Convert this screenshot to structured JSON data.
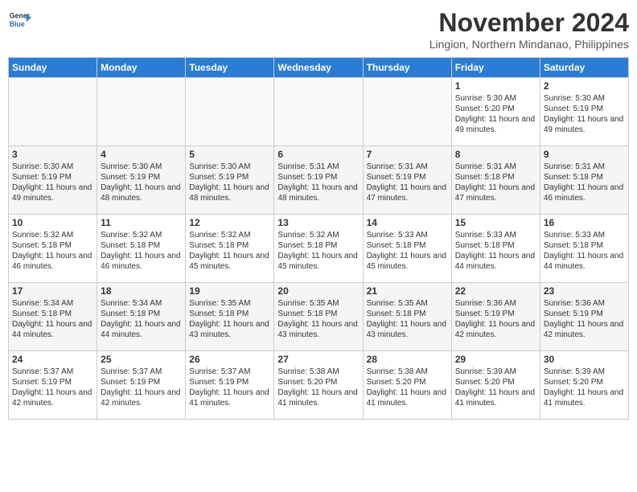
{
  "header": {
    "logo_line1": "General",
    "logo_line2": "Blue",
    "month": "November 2024",
    "location": "Lingion, Northern Mindanao, Philippines"
  },
  "days_of_week": [
    "Sunday",
    "Monday",
    "Tuesday",
    "Wednesday",
    "Thursday",
    "Friday",
    "Saturday"
  ],
  "weeks": [
    [
      {
        "day": "",
        "info": ""
      },
      {
        "day": "",
        "info": ""
      },
      {
        "day": "",
        "info": ""
      },
      {
        "day": "",
        "info": ""
      },
      {
        "day": "",
        "info": ""
      },
      {
        "day": "1",
        "info": "Sunrise: 5:30 AM\nSunset: 5:20 PM\nDaylight: 11 hours and 49 minutes."
      },
      {
        "day": "2",
        "info": "Sunrise: 5:30 AM\nSunset: 5:19 PM\nDaylight: 11 hours and 49 minutes."
      }
    ],
    [
      {
        "day": "3",
        "info": "Sunrise: 5:30 AM\nSunset: 5:19 PM\nDaylight: 11 hours and 49 minutes."
      },
      {
        "day": "4",
        "info": "Sunrise: 5:30 AM\nSunset: 5:19 PM\nDaylight: 11 hours and 48 minutes."
      },
      {
        "day": "5",
        "info": "Sunrise: 5:30 AM\nSunset: 5:19 PM\nDaylight: 11 hours and 48 minutes."
      },
      {
        "day": "6",
        "info": "Sunrise: 5:31 AM\nSunset: 5:19 PM\nDaylight: 11 hours and 48 minutes."
      },
      {
        "day": "7",
        "info": "Sunrise: 5:31 AM\nSunset: 5:19 PM\nDaylight: 11 hours and 47 minutes."
      },
      {
        "day": "8",
        "info": "Sunrise: 5:31 AM\nSunset: 5:18 PM\nDaylight: 11 hours and 47 minutes."
      },
      {
        "day": "9",
        "info": "Sunrise: 5:31 AM\nSunset: 5:18 PM\nDaylight: 11 hours and 46 minutes."
      }
    ],
    [
      {
        "day": "10",
        "info": "Sunrise: 5:32 AM\nSunset: 5:18 PM\nDaylight: 11 hours and 46 minutes."
      },
      {
        "day": "11",
        "info": "Sunrise: 5:32 AM\nSunset: 5:18 PM\nDaylight: 11 hours and 46 minutes."
      },
      {
        "day": "12",
        "info": "Sunrise: 5:32 AM\nSunset: 5:18 PM\nDaylight: 11 hours and 45 minutes."
      },
      {
        "day": "13",
        "info": "Sunrise: 5:32 AM\nSunset: 5:18 PM\nDaylight: 11 hours and 45 minutes."
      },
      {
        "day": "14",
        "info": "Sunrise: 5:33 AM\nSunset: 5:18 PM\nDaylight: 11 hours and 45 minutes."
      },
      {
        "day": "15",
        "info": "Sunrise: 5:33 AM\nSunset: 5:18 PM\nDaylight: 11 hours and 44 minutes."
      },
      {
        "day": "16",
        "info": "Sunrise: 5:33 AM\nSunset: 5:18 PM\nDaylight: 11 hours and 44 minutes."
      }
    ],
    [
      {
        "day": "17",
        "info": "Sunrise: 5:34 AM\nSunset: 5:18 PM\nDaylight: 11 hours and 44 minutes."
      },
      {
        "day": "18",
        "info": "Sunrise: 5:34 AM\nSunset: 5:18 PM\nDaylight: 11 hours and 44 minutes."
      },
      {
        "day": "19",
        "info": "Sunrise: 5:35 AM\nSunset: 5:18 PM\nDaylight: 11 hours and 43 minutes."
      },
      {
        "day": "20",
        "info": "Sunrise: 5:35 AM\nSunset: 5:18 PM\nDaylight: 11 hours and 43 minutes."
      },
      {
        "day": "21",
        "info": "Sunrise: 5:35 AM\nSunset: 5:18 PM\nDaylight: 11 hours and 43 minutes."
      },
      {
        "day": "22",
        "info": "Sunrise: 5:36 AM\nSunset: 5:19 PM\nDaylight: 11 hours and 42 minutes."
      },
      {
        "day": "23",
        "info": "Sunrise: 5:36 AM\nSunset: 5:19 PM\nDaylight: 11 hours and 42 minutes."
      }
    ],
    [
      {
        "day": "24",
        "info": "Sunrise: 5:37 AM\nSunset: 5:19 PM\nDaylight: 11 hours and 42 minutes."
      },
      {
        "day": "25",
        "info": "Sunrise: 5:37 AM\nSunset: 5:19 PM\nDaylight: 11 hours and 42 minutes."
      },
      {
        "day": "26",
        "info": "Sunrise: 5:37 AM\nSunset: 5:19 PM\nDaylight: 11 hours and 41 minutes."
      },
      {
        "day": "27",
        "info": "Sunrise: 5:38 AM\nSunset: 5:20 PM\nDaylight: 11 hours and 41 minutes."
      },
      {
        "day": "28",
        "info": "Sunrise: 5:38 AM\nSunset: 5:20 PM\nDaylight: 11 hours and 41 minutes."
      },
      {
        "day": "29",
        "info": "Sunrise: 5:39 AM\nSunset: 5:20 PM\nDaylight: 11 hours and 41 minutes."
      },
      {
        "day": "30",
        "info": "Sunrise: 5:39 AM\nSunset: 5:20 PM\nDaylight: 11 hours and 41 minutes."
      }
    ]
  ]
}
